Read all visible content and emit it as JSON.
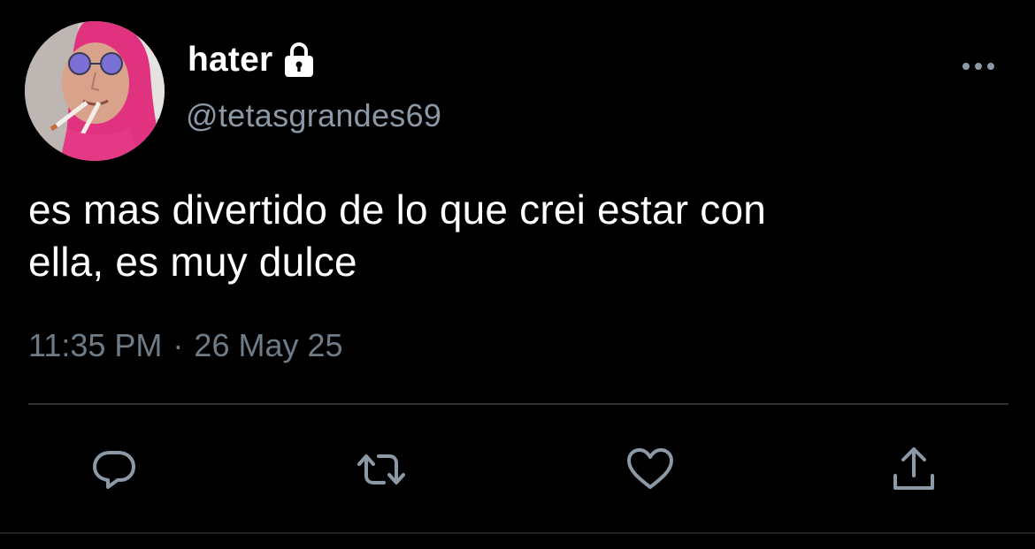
{
  "tweet": {
    "display_name": "hater",
    "handle": "@tetasgrandes69",
    "text_line1": "es mas divertido de lo que crei estar con",
    "text_line2": "ella, es muy dulce",
    "time": "11:35 PM",
    "separator": "·",
    "date": "26 May 25"
  },
  "icons": {
    "lock": "lock-icon",
    "more": "more-horizontal-icon",
    "reply": "reply-icon",
    "retweet": "retweet-icon",
    "like": "heart-icon",
    "share": "share-icon"
  },
  "colors": {
    "background": "#000000",
    "text": "#ffffff",
    "secondary": "#8b98a5",
    "icon": "#8b98a5",
    "divider": "#2f3336"
  }
}
